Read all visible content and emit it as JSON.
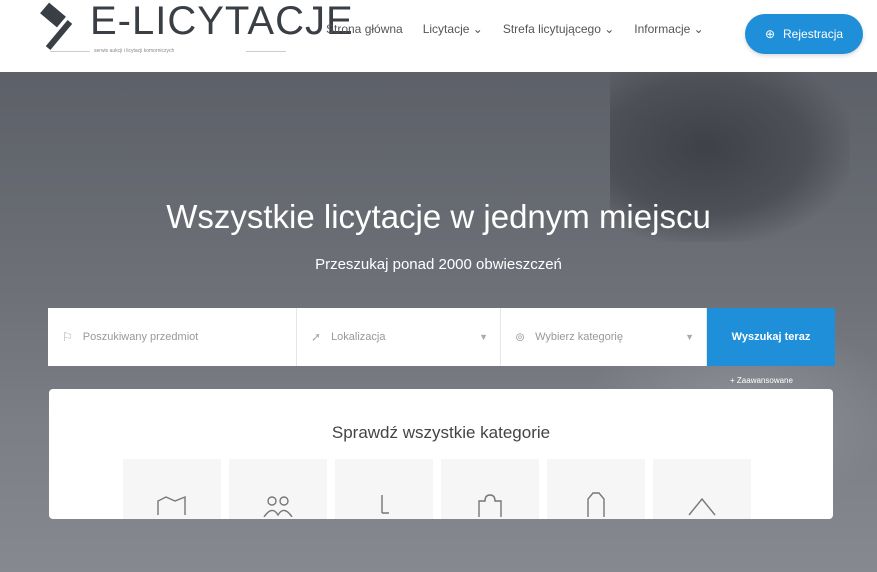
{
  "logo": {
    "name": "E-LICYTACJE",
    "tagline": "serwis aukcji i licytacji komorniczych"
  },
  "nav": {
    "items": [
      "Strona główna",
      "Licytacje",
      "Strefa licytującego",
      "Informacje"
    ]
  },
  "header": {
    "register_label": "Rejestracja"
  },
  "hero": {
    "title": "Wszystkie licytacje w jednym miejscu",
    "subtitle": "Przeszukaj ponad 2000 obwieszczeń"
  },
  "search": {
    "item_placeholder": "Poszukiwany przedmiot",
    "location_placeholder": "Lokalizacja",
    "category_placeholder": "Wybierz kategorię",
    "button_label": "Wyszukaj teraz",
    "advanced_label": "Zaawansowane"
  },
  "categories": {
    "title": "Sprawdź wszystkie kategorie"
  },
  "colors": {
    "accent": "#1e8fd8"
  }
}
